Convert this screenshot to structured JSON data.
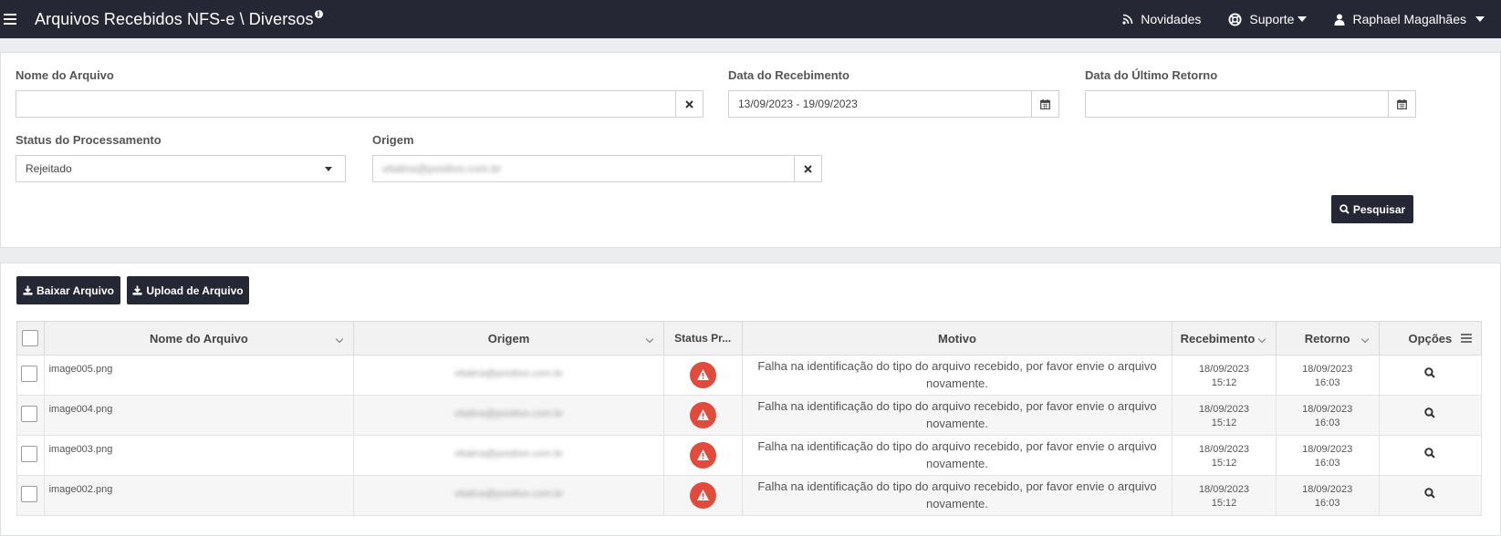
{
  "topbar": {
    "title": "Arquivos Recebidos NFS-e \\ Diversos",
    "info_badge": "i",
    "novidades": "Novidades",
    "suporte": "Suporte",
    "user": "Raphael Magalhães"
  },
  "filters": {
    "nome_label": "Nome do Arquivo",
    "nome_value": "",
    "recebimento_label": "Data do Recebimento",
    "recebimento_value": "13/09/2023 - 19/09/2023",
    "retorno_label": "Data do Último Retorno",
    "retorno_value": "",
    "status_label": "Status do Processamento",
    "status_value": "Rejeitado",
    "origem_label": "Origem",
    "origem_value": "vitalina@positivo.com.br",
    "pesquisar": "Pesquisar"
  },
  "actions": {
    "baixar": "Baixar Arquivo",
    "upload": "Upload de Arquivo"
  },
  "table": {
    "headers": {
      "nome": "Nome do Arquivo",
      "origem": "Origem",
      "status": "Status Pr...",
      "motivo": "Motivo",
      "recebimento": "Recebimento",
      "retorno": "Retorno",
      "opcoes": "Opções"
    },
    "rows": [
      {
        "nome": "image005.png",
        "origem": "vitalina@positivo.com.br",
        "motivo": "Falha na identificação do tipo do arquivo recebido, por favor envie o arquivo novamente.",
        "recebimento_date": "18/09/2023",
        "recebimento_time": "15:12",
        "retorno_date": "18/09/2023",
        "retorno_time": "16:03"
      },
      {
        "nome": "image004.png",
        "origem": "vitalina@positivo.com.br",
        "motivo": "Falha na identificação do tipo do arquivo recebido, por favor envie o arquivo novamente.",
        "recebimento_date": "18/09/2023",
        "recebimento_time": "15:12",
        "retorno_date": "18/09/2023",
        "retorno_time": "16:03"
      },
      {
        "nome": "image003.png",
        "origem": "vitalina@positivo.com.br",
        "motivo": "Falha na identificação do tipo do arquivo recebido, por favor envie o arquivo novamente.",
        "recebimento_date": "18/09/2023",
        "recebimento_time": "15:12",
        "retorno_date": "18/09/2023",
        "retorno_time": "16:03"
      },
      {
        "nome": "image002.png",
        "origem": "vitalina@positivo.com.br",
        "motivo": "Falha na identificação do tipo do arquivo recebido, por favor envie o arquivo novamente.",
        "recebimento_date": "18/09/2023",
        "recebimento_time": "15:12",
        "retorno_date": "18/09/2023",
        "retorno_time": "16:03"
      }
    ]
  },
  "colors": {
    "topbar": "#262735",
    "danger": "#e24b3b"
  }
}
